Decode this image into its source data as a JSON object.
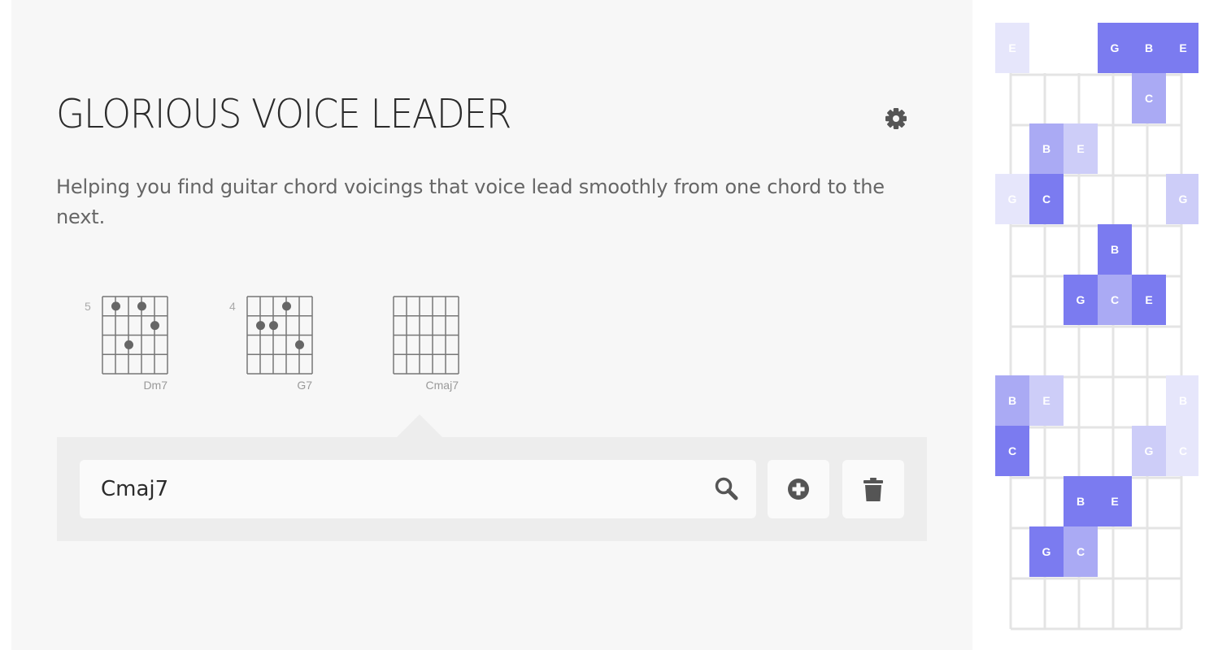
{
  "header": {
    "title": "GLORIOUS VOICE LEADER",
    "subtitle": "Helping you find guitar chord voicings that voice lead smoothly from one chord to the next.",
    "settings_icon": "gear-icon"
  },
  "chords": [
    {
      "name": "Dm7",
      "base_fret": "5",
      "dots": [
        [
          0,
          1
        ],
        [
          0,
          3
        ],
        [
          1,
          4
        ],
        [
          2,
          2
        ]
      ]
    },
    {
      "name": "G7",
      "base_fret": "4",
      "dots": [
        [
          0,
          3
        ],
        [
          1,
          1
        ],
        [
          1,
          2
        ],
        [
          2,
          4
        ]
      ]
    },
    {
      "name": "Cmaj7",
      "base_fret": "",
      "dots": []
    }
  ],
  "editor": {
    "input_value": "Cmaj7",
    "search_icon": "search-icon",
    "add_icon": "plus-circle-icon",
    "delete_icon": "trash-icon"
  },
  "fretboard": {
    "strings": 6,
    "frets": 12,
    "colors": {
      "strong": "#7b7bf0",
      "medium": "#aaaaf4",
      "light": "#cdcdf8",
      "faint": "#e6e6fb"
    },
    "notes": [
      {
        "fret": 0,
        "string": 0,
        "label": "E",
        "level": "faint"
      },
      {
        "fret": 0,
        "string": 3,
        "label": "G",
        "level": "strong"
      },
      {
        "fret": 0,
        "string": 4,
        "label": "B",
        "level": "strong"
      },
      {
        "fret": 0,
        "string": 5,
        "label": "E",
        "level": "strong"
      },
      {
        "fret": 1,
        "string": 4,
        "label": "C",
        "level": "medium"
      },
      {
        "fret": 2,
        "string": 1,
        "label": "B",
        "level": "medium"
      },
      {
        "fret": 2,
        "string": 2,
        "label": "E",
        "level": "light"
      },
      {
        "fret": 3,
        "string": 0,
        "label": "G",
        "level": "faint"
      },
      {
        "fret": 3,
        "string": 1,
        "label": "C",
        "level": "strong"
      },
      {
        "fret": 3,
        "string": 5,
        "label": "G",
        "level": "light"
      },
      {
        "fret": 4,
        "string": 3,
        "label": "B",
        "level": "strong"
      },
      {
        "fret": 5,
        "string": 2,
        "label": "G",
        "level": "strong"
      },
      {
        "fret": 5,
        "string": 3,
        "label": "C",
        "level": "medium"
      },
      {
        "fret": 5,
        "string": 4,
        "label": "E",
        "level": "strong"
      },
      {
        "fret": 7,
        "string": 0,
        "label": "B",
        "level": "medium"
      },
      {
        "fret": 7,
        "string": 1,
        "label": "E",
        "level": "light"
      },
      {
        "fret": 7,
        "string": 5,
        "label": "B",
        "level": "faint"
      },
      {
        "fret": 8,
        "string": 0,
        "label": "C",
        "level": "strong"
      },
      {
        "fret": 8,
        "string": 4,
        "label": "G",
        "level": "light"
      },
      {
        "fret": 8,
        "string": 5,
        "label": "C",
        "level": "faint"
      },
      {
        "fret": 9,
        "string": 2,
        "label": "B",
        "level": "strong"
      },
      {
        "fret": 9,
        "string": 3,
        "label": "E",
        "level": "strong"
      },
      {
        "fret": 10,
        "string": 1,
        "label": "G",
        "level": "strong"
      },
      {
        "fret": 10,
        "string": 2,
        "label": "C",
        "level": "medium"
      }
    ]
  }
}
